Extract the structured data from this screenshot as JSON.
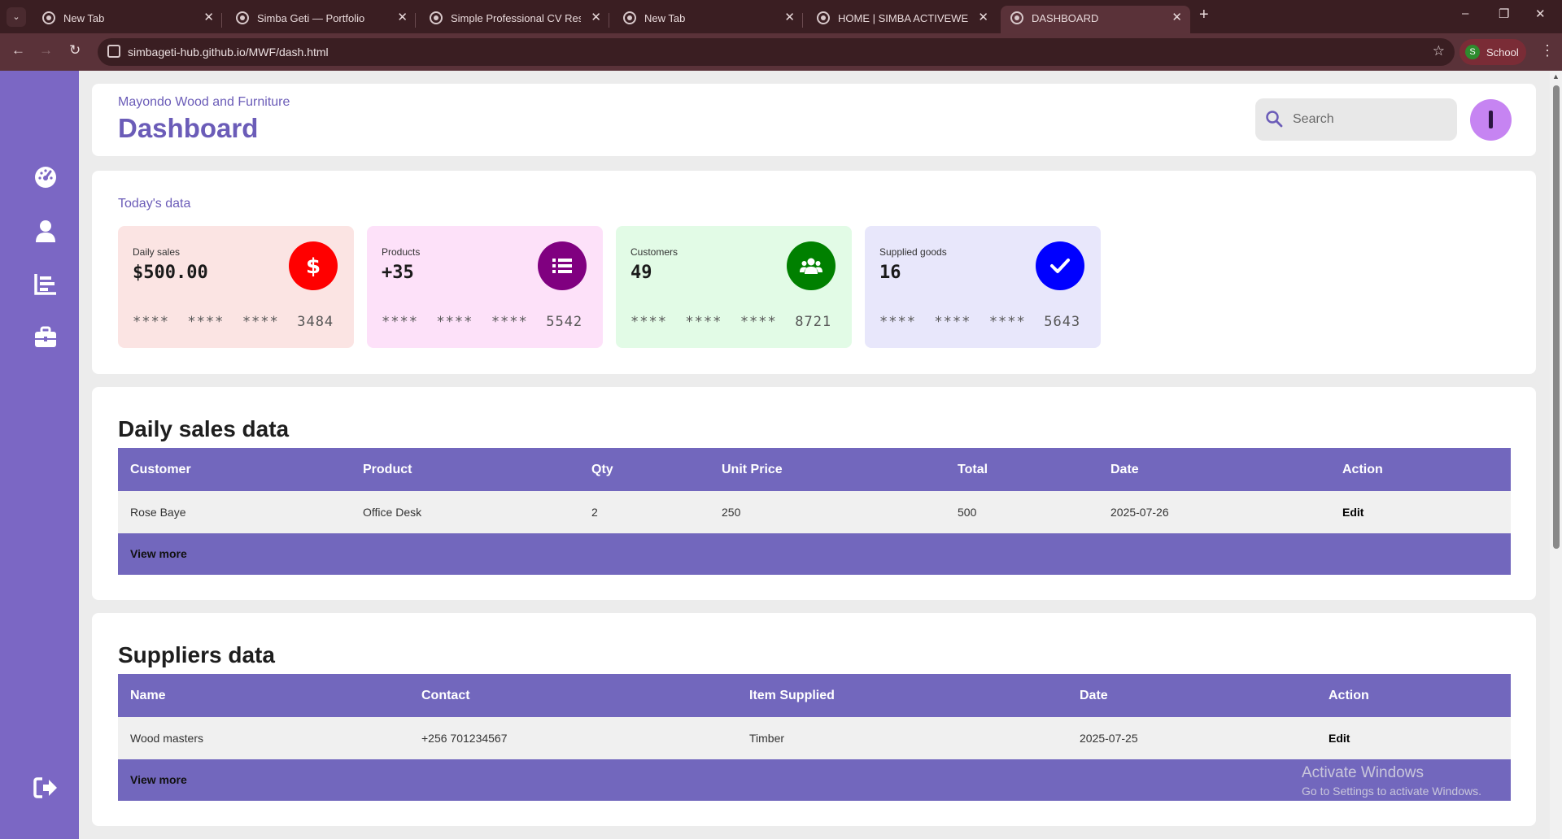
{
  "browser": {
    "tabs": [
      {
        "title": "New Tab",
        "active": false
      },
      {
        "title": "Simba Geti — Portfolio",
        "active": false
      },
      {
        "title": "Simple Professional CV Resume",
        "active": false
      },
      {
        "title": "New Tab",
        "active": false
      },
      {
        "title": "HOME | SIMBA ACTIVEWEAR",
        "active": false
      },
      {
        "title": "DASHBOARD",
        "active": true
      }
    ],
    "url": "simbageti-hub.github.io/MWF/dash.html",
    "profile_label": "School",
    "profile_initial": "S"
  },
  "sidebar": {
    "icons": [
      "dashboard-gauge-icon",
      "user-icon",
      "chart-bars-icon",
      "briefcase-icon",
      "logout-icon"
    ]
  },
  "header": {
    "company": "Mayondo Wood and Furniture",
    "title": "Dashboard",
    "search_placeholder": "Search"
  },
  "today": {
    "heading": "Today's data",
    "cards": [
      {
        "label": "Daily sales",
        "value": "$500.00",
        "masked": "****  ****  ****  3484",
        "icon": "dollar-icon",
        "color": "#ff0000",
        "bg": "#fbe4e3"
      },
      {
        "label": "Products",
        "value": "+35",
        "masked": "****  ****  ****  5542",
        "icon": "list-icon",
        "color": "#800080",
        "bg": "#fde1f9"
      },
      {
        "label": "Customers",
        "value": "49",
        "masked": "****  ****  ****  8721",
        "icon": "users-icon",
        "color": "#008000",
        "bg": "#e2fbe6"
      },
      {
        "label": "Supplied goods",
        "value": "16",
        "masked": "****  ****  ****  5643",
        "icon": "check-icon",
        "color": "#0000ff",
        "bg": "#e8e7fb"
      }
    ]
  },
  "sales": {
    "title": "Daily sales data",
    "columns": [
      "Customer",
      "Product",
      "Qty",
      "Unit Price",
      "Total",
      "Date",
      "Action"
    ],
    "rows": [
      [
        "Rose Baye",
        "Office Desk",
        "2",
        "250",
        "500",
        "2025-07-26",
        "Edit"
      ]
    ],
    "footer": "View more"
  },
  "suppliers": {
    "title": "Suppliers data",
    "columns": [
      "Name",
      "Contact",
      "Item Supplied",
      "Date",
      "Action"
    ],
    "rows": [
      [
        "Wood masters",
        "+256 701234567",
        "Timber",
        "2025-07-25",
        "Edit"
      ]
    ],
    "footer": "View more"
  },
  "watermark": {
    "line1": "Activate Windows",
    "line2": "Go to Settings to activate Windows."
  },
  "colors": {
    "sidebar": "#7b67c4",
    "table_header": "#7267bd",
    "accent_text": "#6b5cb8"
  }
}
